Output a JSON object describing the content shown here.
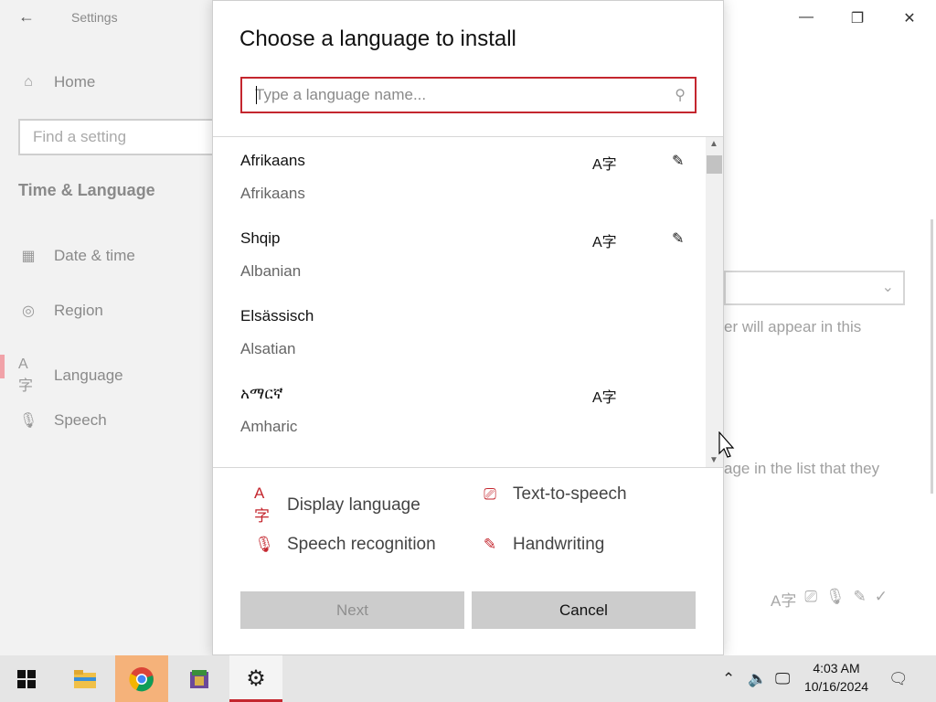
{
  "settings": {
    "title": "Settings",
    "home_label": "Home",
    "find_placeholder": "Find a setting",
    "section_title": "Time & Language",
    "nav": [
      {
        "label": "Date & time",
        "icon": "calendar-clock-icon"
      },
      {
        "label": "Region",
        "icon": "globe-icon"
      },
      {
        "label": "Language",
        "icon": "language-icon"
      },
      {
        "label": "Speech",
        "icon": "microphone-icon"
      }
    ],
    "bg_text_1": "er will appear in this",
    "bg_text_2": "age in the list that they"
  },
  "dialog": {
    "title": "Choose a language to install",
    "search_placeholder": "Type a language name...",
    "languages": [
      {
        "native": "Afrikaans",
        "english": "Afrikaans",
        "display": true,
        "handwriting": true
      },
      {
        "native": "Shqip",
        "english": "Albanian",
        "display": true,
        "handwriting": true
      },
      {
        "native": "Elsässisch",
        "english": "Alsatian",
        "display": false,
        "handwriting": false
      },
      {
        "native": "አማርኛ",
        "english": "Amharic",
        "display": true,
        "handwriting": false
      }
    ],
    "legend": {
      "display": "Display language",
      "tts": "Text-to-speech",
      "speech": "Speech recognition",
      "handwriting": "Handwriting"
    },
    "next_label": "Next",
    "cancel_label": "Cancel",
    "accent_color": "#c4262e"
  },
  "taskbar": {
    "time": "4:03 AM",
    "date": "10/16/2024"
  }
}
